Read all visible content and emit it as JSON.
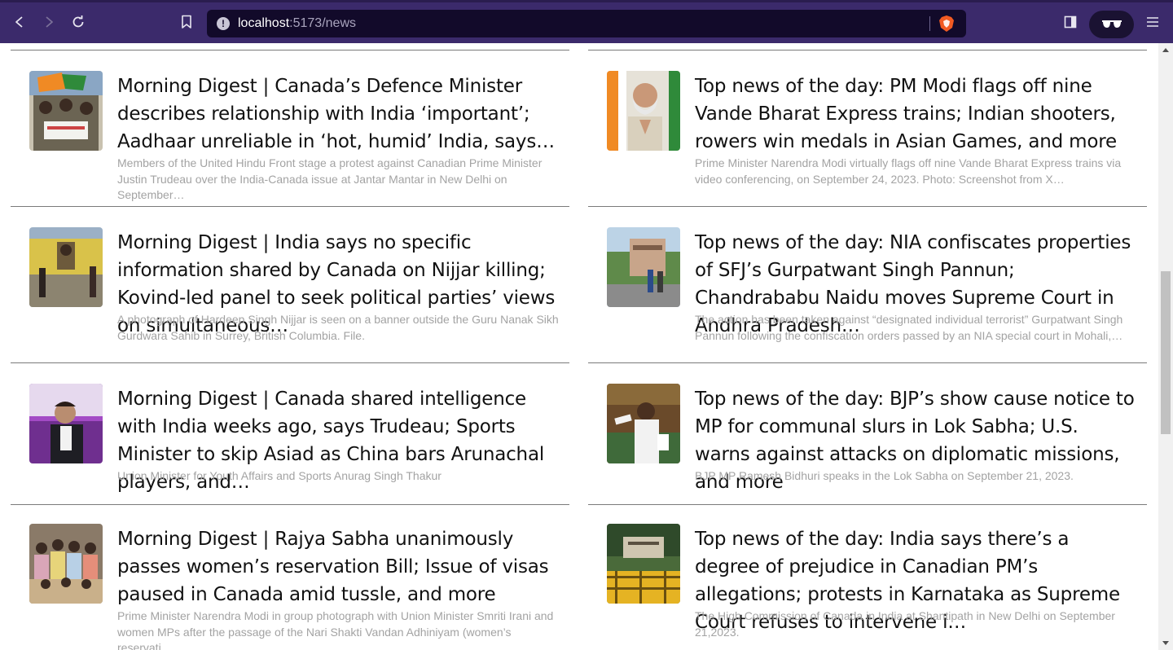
{
  "browser": {
    "url_host": "localhost",
    "url_rest": ":5173/news"
  },
  "colors": {
    "toolbar": "#3b2a6b",
    "urlbar": "#120a2a",
    "rule": "#7a7a7a",
    "caption": "#a3a3a3"
  },
  "news": {
    "left": [
      {
        "title": "Morning Digest | Canada’s Defence Minister describes relationship with India ‘important’; Aadhaar unreliable in ‘hot, humid’ India, says…",
        "caption": "Members of the United Hindu Front stage a protest against Canadian Prime Minister Justin Trudeau over the India-Canada issue at Jantar Mantar in New Delhi on September…"
      },
      {
        "title": "Morning Digest | India says no specific information shared by Canada on Nijjar killing; Kovind-led panel to seek political parties’ views on simultaneous…",
        "caption": "A photograph of Hardeep Singh Nijjar is seen on a banner outside the Guru Nanak Sikh Gurdwara Sahib in Surrey, British Columbia. File."
      },
      {
        "title": "Morning Digest | Canada shared intelligence with India weeks ago, says Trudeau; Sports Minister to skip Asiad as China bars Arunachal players, and…",
        "caption": "Union Minister for Youth Affairs and Sports Anurag Singh Thakur"
      },
      {
        "title": "Morning Digest | Rajya Sabha unanimously passes women’s reservation Bill; Issue of visas paused in Canada amid tussle, and more",
        "caption": "Prime Minister Narendra Modi in group photograph with Union Minister Smriti Irani and women MPs after the passage of the Nari Shakti Vandan Adhiniyam (women’s reservati…"
      }
    ],
    "right": [
      {
        "title": "Top news of the day: PM Modi flags off nine Vande Bharat Express trains; Indian shooters, rowers win medals in Asian Games, and more",
        "caption": "Prime Minister Narendra Modi virtually flags off nine Vande Bharat Express trains via video conferencing, on September 24, 2023. Photo: Screenshot from X…"
      },
      {
        "title": "Top news of the day: NIA confiscates properties of SFJ’s Gurpatwant Singh Pannun; Chandrababu Naidu moves Supreme Court in Andhra Pradesh…",
        "caption": "The action has been taken against “designated individual terrorist” Gurpatwant Singh Pannun following the confiscation orders passed by an NIA special court in Mohali,…"
      },
      {
        "title": "Top news of the day: BJP’s show cause notice to MP for communal slurs in Lok Sabha; U.S. warns against attacks on diplomatic missions, and more",
        "caption": "BJP MP Ramesh Bidhuri speaks in the Lok Sabha on September 21, 2023."
      },
      {
        "title": "Top news of the day: India says there’s a degree of prejudice in Canadian PM’s allegations; protests in Karnataka as Supreme Court refuses to intervene i…",
        "caption": "The High Commission of Canada in India at Shantipath in New Delhi on September 21,2023."
      }
    ]
  }
}
